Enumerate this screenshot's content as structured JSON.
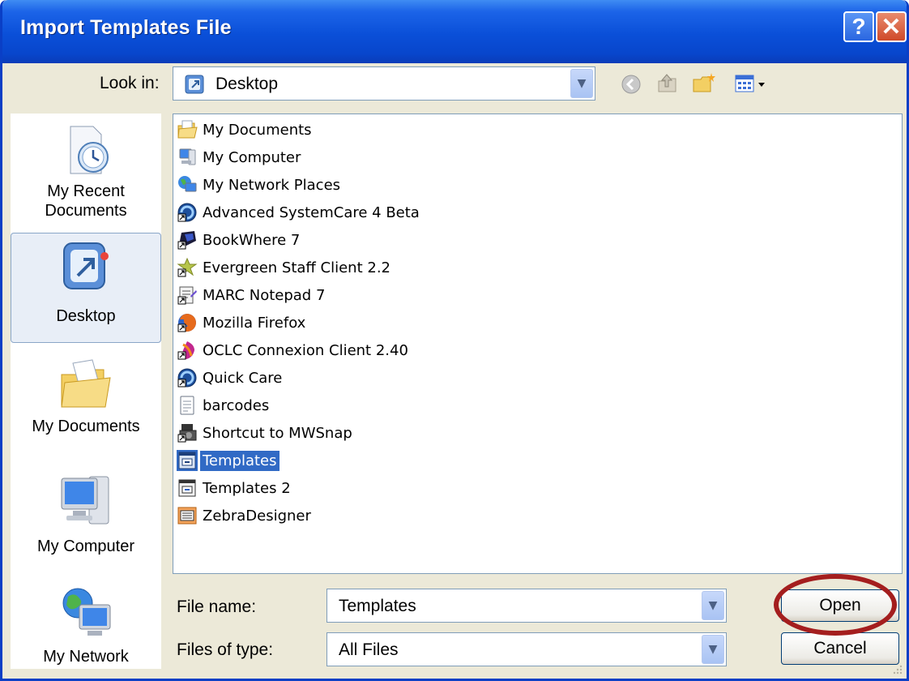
{
  "window": {
    "title": "Import Templates File"
  },
  "titlebar": {
    "help_label": "?",
    "close_label": "✕"
  },
  "lookin": {
    "label": "Look in:",
    "value": "Desktop"
  },
  "toolbar": {
    "icons": [
      "back-icon",
      "up-folder-icon",
      "new-folder-icon",
      "view-menu-icon"
    ]
  },
  "places": [
    {
      "label": "My Recent Documents",
      "icon": "recent-documents-icon"
    },
    {
      "label": "Desktop",
      "icon": "desktop-icon",
      "selected": true
    },
    {
      "label": "My Documents",
      "icon": "my-documents-icon"
    },
    {
      "label": "My Computer",
      "icon": "my-computer-icon"
    },
    {
      "label": "My Network",
      "icon": "my-network-icon"
    }
  ],
  "files": [
    {
      "name": "My Documents",
      "icon": "folder-docs-icon"
    },
    {
      "name": "My Computer",
      "icon": "computer-icon"
    },
    {
      "name": "My Network Places",
      "icon": "network-icon"
    },
    {
      "name": "Advanced SystemCare 4 Beta",
      "icon": "systemcare-icon"
    },
    {
      "name": "BookWhere 7",
      "icon": "bookwhere-icon"
    },
    {
      "name": "Evergreen Staff Client 2.2",
      "icon": "evergreen-icon"
    },
    {
      "name": "MARC Notepad 7",
      "icon": "marc-notepad-icon"
    },
    {
      "name": "Mozilla Firefox",
      "icon": "firefox-icon"
    },
    {
      "name": "OCLC Connexion Client 2.40",
      "icon": "oclc-icon"
    },
    {
      "name": "Quick Care",
      "icon": "quickcare-icon"
    },
    {
      "name": "barcodes",
      "icon": "text-file-icon"
    },
    {
      "name": "Shortcut to MWSnap",
      "icon": "mwsnap-icon"
    },
    {
      "name": "Templates",
      "icon": "template-file-icon",
      "selected": true
    },
    {
      "name": "Templates 2",
      "icon": "template-file-icon"
    },
    {
      "name": "ZebraDesigner",
      "icon": "zebradesigner-icon"
    }
  ],
  "filename": {
    "label": "File name:",
    "value": "Templates"
  },
  "filetype": {
    "label": "Files of type:",
    "value": "All Files"
  },
  "buttons": {
    "open": "Open",
    "cancel": "Cancel"
  },
  "colors": {
    "titlebar": "#0a4fd8",
    "selection": "#316ac5",
    "highlight_ring": "#a41e1e"
  }
}
